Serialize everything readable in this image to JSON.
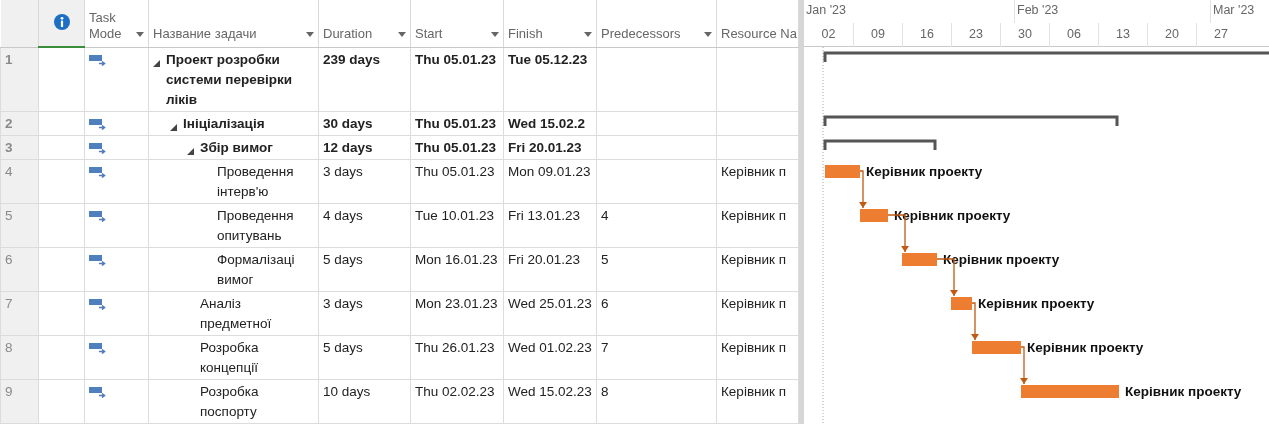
{
  "columns": [
    {
      "label": "Task Mode",
      "filter": true
    },
    {
      "label": "Название задачи",
      "filter": true
    },
    {
      "label": "Duration",
      "filter": true
    },
    {
      "label": "Start",
      "filter": true
    },
    {
      "label": "Finish",
      "filter": true
    },
    {
      "label": "Predecessors",
      "filter": true
    },
    {
      "label": "Resource Na",
      "filter": false
    }
  ],
  "timeline": {
    "months": [
      "Jan '23",
      "Feb '23",
      "Mar '23"
    ],
    "weeks": [
      "02",
      "09",
      "16",
      "23",
      "30",
      "06",
      "13",
      "20",
      "27"
    ]
  },
  "tasks": [
    {
      "id": "1",
      "kind": "summary",
      "expanded": true,
      "name": "Проект розробки системи перевірки ліків",
      "duration": "239 days",
      "start": "Thu 05.01.23",
      "finish": "Tue 05.12.23",
      "children": [
        {
          "id": "2",
          "kind": "summary",
          "expanded": true,
          "name": "Ініціалізація",
          "duration": "30 days",
          "start": "Thu 05.01.23",
          "finish": "Wed 15.02.2",
          "children": [
            {
              "id": "3",
              "kind": "summary",
              "expanded": true,
              "name": "Збір вимог",
              "duration": "12 days",
              "start": "Thu 05.01.23",
              "finish": "Fri 20.01.23",
              "children": [
                {
                  "id": "4",
                  "kind": "task",
                  "name": "Проведення інтерв'ю",
                  "duration": "3 days",
                  "start": "Thu 05.01.23",
                  "finish": "Mon 09.01.23",
                  "resource": "Керівник п",
                  "bar_label": "Керівник проекту"
                },
                {
                  "id": "5",
                  "kind": "task",
                  "name": "Проведення опитувань",
                  "duration": "4 days",
                  "start": "Tue 10.01.23",
                  "finish": "Fri 13.01.23",
                  "predecessors": "4",
                  "resource": "Керівник п",
                  "bar_label": "Керівник проекту"
                },
                {
                  "id": "6",
                  "kind": "task",
                  "name": "Формалізаці вимог",
                  "duration": "5 days",
                  "start": "Mon 16.01.23",
                  "finish": "Fri 20.01.23",
                  "predecessors": "5",
                  "resource": "Керівник п",
                  "bar_label": "Керівник проекту"
                }
              ]
            },
            {
              "id": "7",
              "kind": "task",
              "name": "Аналіз предметної",
              "duration": "3 days",
              "start": "Mon 23.01.23",
              "finish": "Wed 25.01.23",
              "predecessors": "6",
              "resource": "Керівник п",
              "bar_label": "Керівник проекту"
            },
            {
              "id": "8",
              "kind": "task",
              "name": "Розробка концепції",
              "duration": "5 days",
              "start": "Thu 26.01.23",
              "finish": "Wed 01.02.23",
              "predecessors": "7",
              "resource": "Керівник п",
              "bar_label": "Керівник проекту"
            },
            {
              "id": "9",
              "kind": "task",
              "name": "Розробка поспорту",
              "duration": "10 days",
              "start": "Thu 02.02.23",
              "finish": "Wed 15.02.23",
              "predecessors": "8",
              "resource": "Керівник п",
              "bar_label": "Керівник проекту"
            }
          ]
        }
      ]
    }
  ]
}
